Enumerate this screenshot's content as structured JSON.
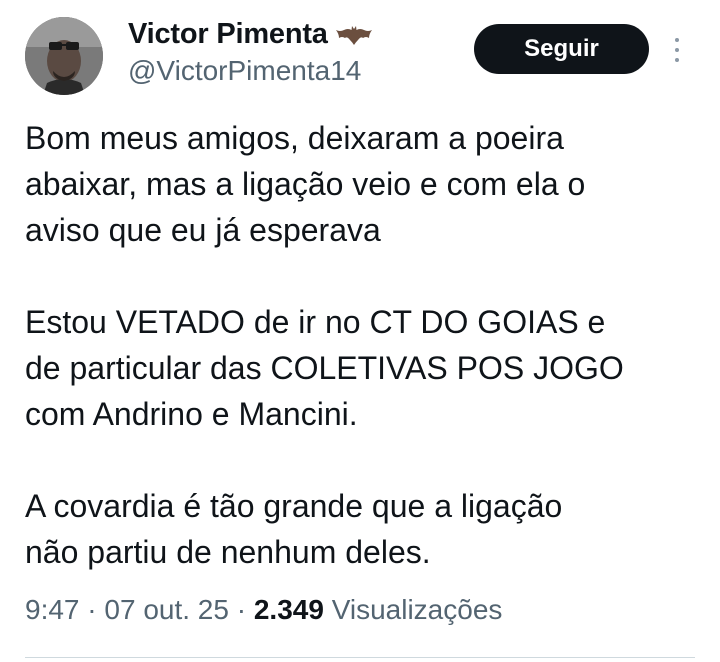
{
  "author": {
    "display_name": "Victor Pimenta",
    "handle": "@VictorPimenta14",
    "badge_icon": "bat-icon",
    "avatar_icon": "profile-photo"
  },
  "actions": {
    "follow_label": "Seguir",
    "more_icon": "more-vertical-icon"
  },
  "tweet": {
    "paragraphs": [
      [
        "Bom meus amigos, deixaram a poeira",
        "abaixar, mas a ligação veio e com ela o",
        "aviso que eu já esperava"
      ],
      [
        "Estou VETADO de ir no CT DO GOIAS e",
        "de particular das COLETIVAS POS JOGO",
        "com Andrino e Mancini."
      ],
      [
        "A covardia é tão grande que a ligação",
        "não partiu de nenhum deles."
      ]
    ]
  },
  "meta": {
    "time": "9:47",
    "sep1": " · ",
    "date": "07 out. 25",
    "sep2": " · ",
    "views_count": "2.349",
    "views_label": " Visualizações"
  },
  "colors": {
    "text": "#0f1419",
    "secondary": "#536471",
    "button_bg": "#0f1419",
    "divider": "#cfd9de"
  }
}
